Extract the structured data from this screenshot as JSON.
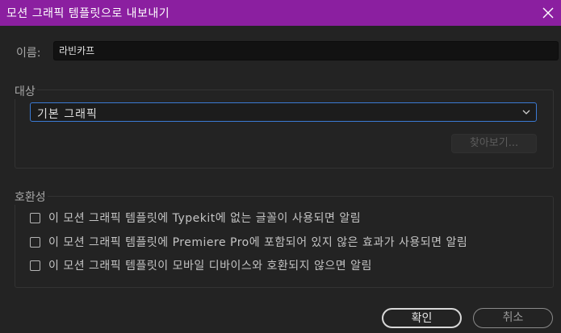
{
  "window": {
    "title": "모션 그래픽 템플릿으로 내보내기",
    "close_icon": "close-icon"
  },
  "name_field": {
    "label": "이름:",
    "value": "라빈카프"
  },
  "destination": {
    "group_title": "대상",
    "selected": "기본 그래픽",
    "dropdown_icon": "chevron-down-icon",
    "browse_label": "찾아보기..."
  },
  "compatibility": {
    "group_title": "호환성",
    "options": [
      {
        "label": "이 모션 그래픽 템플릿에 Typekit에 없는 글꼴이 사용되면 알림",
        "checked": false
      },
      {
        "label": "이 모션 그래픽 템플릿에 Premiere Pro에 포함되어 있지 않은 효과가 사용되면 알림",
        "checked": false
      },
      {
        "label": "이 모션 그래픽 템플릿이 모바일 디바이스와 호환되지 않으면 알림",
        "checked": false
      }
    ]
  },
  "buttons": {
    "ok": "확인",
    "cancel": "취소"
  },
  "colors": {
    "titlebar": "#8b1fa0",
    "background": "#232323",
    "focus_border": "#3b7ad4"
  }
}
